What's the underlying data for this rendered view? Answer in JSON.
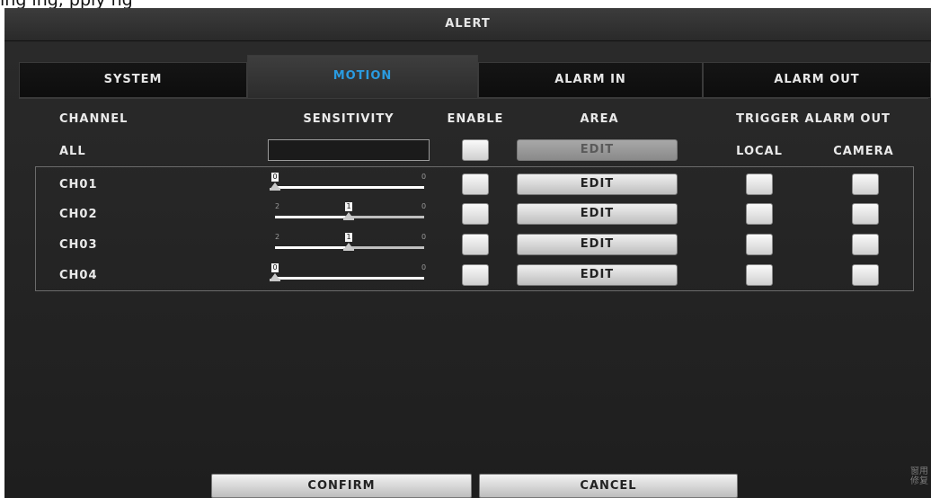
{
  "overlay_text": "ing ing, pply ng",
  "window": {
    "title": "ALERT"
  },
  "tabs": [
    {
      "label": "SYSTEM",
      "active": false
    },
    {
      "label": "MOTION",
      "active": true
    },
    {
      "label": "ALARM IN",
      "active": false
    },
    {
      "label": "ALARM OUT",
      "active": false
    }
  ],
  "headers": {
    "channel": "CHANNEL",
    "sensitivity": "SENSITIVITY",
    "enable": "ENABLE",
    "area": "AREA",
    "trigger_alarm_out": "TRIGGER ALARM OUT",
    "local": "LOCAL",
    "camera": "CAMERA"
  },
  "all_row": {
    "label": "ALL",
    "sensitivity_value": "",
    "edit_label": "EDIT",
    "edit_disabled": true
  },
  "channels": [
    {
      "label": "CH01",
      "sensitivity": 0,
      "slider_min_label": "",
      "slider_max_label": "0",
      "edit_label": "EDIT"
    },
    {
      "label": "CH02",
      "sensitivity": 1,
      "slider_min_label": "2",
      "slider_max_label": "0",
      "edit_label": "EDIT"
    },
    {
      "label": "CH03",
      "sensitivity": 1,
      "slider_min_label": "2",
      "slider_max_label": "0",
      "edit_label": "EDIT"
    },
    {
      "label": "CH04",
      "sensitivity": 0,
      "slider_min_label": "",
      "slider_max_label": "0",
      "edit_label": "EDIT"
    }
  ],
  "footer": {
    "confirm_label": "CONFIRM",
    "cancel_label": "CANCEL"
  },
  "corner_text": "窗用 修复",
  "colors": {
    "active_tab": "#2a9be0",
    "background": "#232323"
  }
}
